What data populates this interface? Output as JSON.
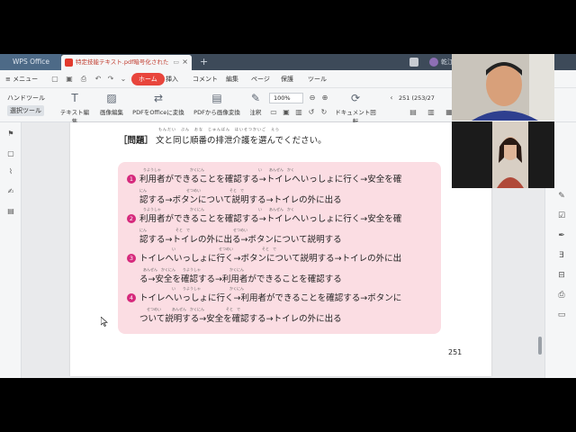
{
  "titlebar": {
    "app_tab": "WPS Office",
    "doc_tab": "特定技能テキスト.pdf暗号化された",
    "user_text": "乾江"
  },
  "menubar": {
    "menu_label": "≡ メニュー",
    "tabs": [
      "ホーム",
      "挿入",
      "コメント",
      "編集",
      "ページ",
      "保護",
      "ツール"
    ]
  },
  "toolbar": {
    "hand_tool": "ハンドツール",
    "select_tool": "選択ツール",
    "tools": [
      "テキスト編集",
      "画像編集",
      "PDFをOfficeに変換",
      "PDFから画像変換",
      "注釈",
      "ドキュメント回転"
    ],
    "zoom": "100%",
    "page_indicator": "251 (253/27"
  },
  "document": {
    "question_bracket": "［問題］",
    "question_text": "文と同じ順番の排泄介護を選んでください。",
    "question_furigana": "もんだい　ぶん　おな　じゅんばん　はいせつかいご　えら",
    "options": [
      {
        "number": "1",
        "line1": "利用者ができることを確認する→トイレへいっしょに行く→安全を確",
        "line2": "認する→ボタンについて説明する→トイレの外に出る",
        "furi1": "りようしゃ　　　　　　　　かくにん　　　　　　　　　　　　　　　い　　あんぜん　かく",
        "furi2": "にん　　　　　　　　　　　せつめい　　　　　　　　そと　で"
      },
      {
        "number": "2",
        "line1": "利用者ができることを確認する→トイレへいっしょに行く→安全を確",
        "line2": "認する→トイレの外に出る→ボタンについて説明する",
        "furi1": "りようしゃ　　　　　　　　かくにん　　　　　　　　　　　　　　　い　　あんぜん　かく",
        "furi2": "にん　　　　　　　　そと　で　　　　　　　　　　　　せつめい"
      },
      {
        "number": "3",
        "line1": "トイレへいっしょに行く→ボタンについて説明する→トイレの外に出",
        "line2": "る→安全を確認する→利用者ができることを確認する",
        "furi1": "　　　　　　　　い　　　　　　　　　　　　せつめい　　　　　　　　そと　で",
        "furi2": "　あんぜん　かくにん　　りようしゃ　　　　　　　　かくにん"
      },
      {
        "number": "4",
        "line1": "トイレへいっしょに行く→利用者ができることを確認する→ボタンに",
        "line2": "ついて説明する→安全を確認する→トイレの外に出る",
        "furi1": "　　　　　　　　い　　りようしゃ　　　　　　　　かくにん",
        "furi2": "　　せつめい　　　あんぜん　かくにん　　　　　　そと　で"
      }
    ],
    "page_number": "251"
  },
  "colors": {
    "accent": "#e8453c",
    "option_badge": "#d6297c",
    "option_box": "#fbdde3"
  }
}
